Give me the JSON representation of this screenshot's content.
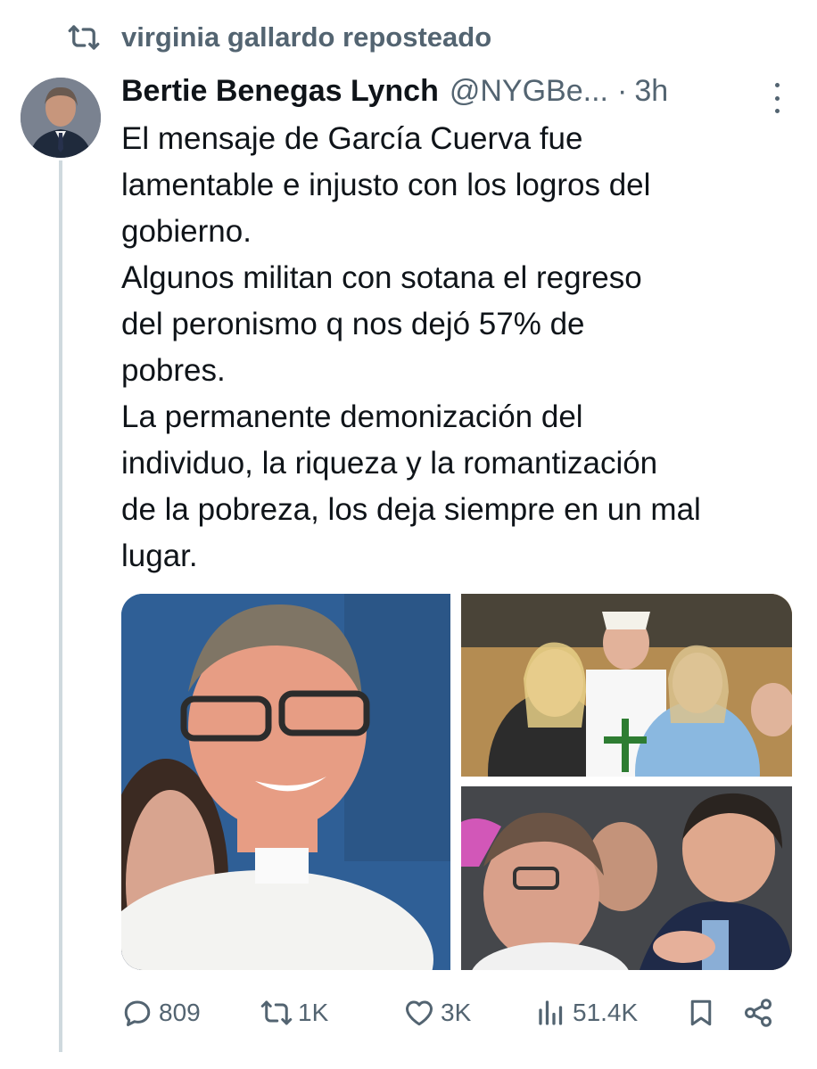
{
  "repost": {
    "icon": "repost-icon",
    "text": "virginia gallardo reposteado"
  },
  "tweet": {
    "author_name": "Bertie Benegas Lynch",
    "handle": "@NYGBe...",
    "separator": "·",
    "time": "3h",
    "text": "El mensaje de García Cuerva fue\nlamentable e injusto con los logros del\ngobierno.\nAlgunos militan con sotana el regreso\ndel peronismo q nos dejó 57% de\npobres.\nLa permanente demonización del\nindividuo, la riqueza y la romantización\nde la pobreza, los deja siempre en un mal\nlugar.",
    "media_count": 3
  },
  "actions": {
    "replies": "809",
    "reposts": "1K",
    "likes": "3K",
    "views": "51.4K"
  },
  "colors": {
    "text_primary": "#0f1419",
    "text_secondary": "#536471",
    "thread_line": "#cfd9de",
    "background": "#ffffff"
  },
  "icons": [
    "repost-icon",
    "more-options-icon",
    "reply-icon",
    "retweet-icon",
    "like-icon",
    "views-icon",
    "bookmark-icon",
    "share-icon"
  ]
}
